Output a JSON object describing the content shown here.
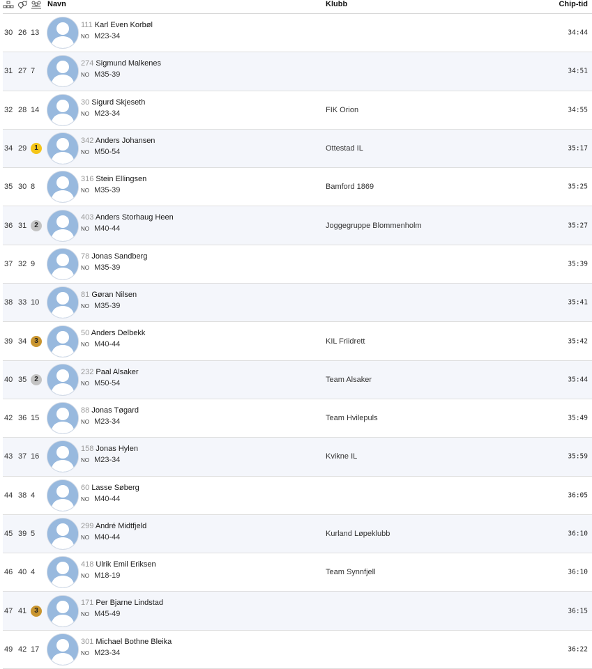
{
  "header": {
    "icons": [
      "overall-place-icon",
      "gender-place-icon",
      "class-place-icon"
    ],
    "navn": "Navn",
    "klubb": "Klubb",
    "chip": "Chip-tid"
  },
  "colors": {
    "gold": "#f5c518",
    "silver": "#c3c3c3",
    "bronze": "#c9952f",
    "avatar": "#98b9de",
    "row_alt": "#f4f6fb"
  },
  "rows": [
    {
      "place": "30",
      "gender": "26",
      "cls_place": "13",
      "medal": "",
      "bib": "111",
      "name": "Karl Even Korbøl",
      "nat": "NO",
      "cls": "M23-34",
      "club": "",
      "time": "34:44"
    },
    {
      "place": "31",
      "gender": "27",
      "cls_place": "7",
      "medal": "",
      "bib": "274",
      "name": "Sigmund Malkenes",
      "nat": "NO",
      "cls": "M35-39",
      "club": "",
      "time": "34:51"
    },
    {
      "place": "32",
      "gender": "28",
      "cls_place": "14",
      "medal": "",
      "bib": "30",
      "name": "Sigurd Skjeseth",
      "nat": "NO",
      "cls": "M23-34",
      "club": "FIK Orion",
      "time": "34:55"
    },
    {
      "place": "34",
      "gender": "29",
      "cls_place": "1",
      "medal": "gold",
      "bib": "342",
      "name": "Anders Johansen",
      "nat": "NO",
      "cls": "M50-54",
      "club": "Ottestad IL",
      "time": "35:17"
    },
    {
      "place": "35",
      "gender": "30",
      "cls_place": "8",
      "medal": "",
      "bib": "316",
      "name": "Stein Ellingsen",
      "nat": "NO",
      "cls": "M35-39",
      "club": "Bamford 1869",
      "time": "35:25"
    },
    {
      "place": "36",
      "gender": "31",
      "cls_place": "2",
      "medal": "silver",
      "bib": "403",
      "name": "Anders Storhaug Heen",
      "nat": "NO",
      "cls": "M40-44",
      "club": "Joggegruppe Blommenholm",
      "time": "35:27"
    },
    {
      "place": "37",
      "gender": "32",
      "cls_place": "9",
      "medal": "",
      "bib": "78",
      "name": "Jonas Sandberg",
      "nat": "NO",
      "cls": "M35-39",
      "club": "",
      "time": "35:39"
    },
    {
      "place": "38",
      "gender": "33",
      "cls_place": "10",
      "medal": "",
      "bib": "81",
      "name": "Gøran Nilsen",
      "nat": "NO",
      "cls": "M35-39",
      "club": "",
      "time": "35:41"
    },
    {
      "place": "39",
      "gender": "34",
      "cls_place": "3",
      "medal": "bronze",
      "bib": "50",
      "name": "Anders Delbekk",
      "nat": "NO",
      "cls": "M40-44",
      "club": "KIL Friidrett",
      "time": "35:42"
    },
    {
      "place": "40",
      "gender": "35",
      "cls_place": "2",
      "medal": "silver",
      "bib": "232",
      "name": "Paal Alsaker",
      "nat": "NO",
      "cls": "M50-54",
      "club": "Team Alsaker",
      "time": "35:44"
    },
    {
      "place": "42",
      "gender": "36",
      "cls_place": "15",
      "medal": "",
      "bib": "88",
      "name": "Jonas Tøgard",
      "nat": "NO",
      "cls": "M23-34",
      "club": "Team Hvilepuls",
      "time": "35:49"
    },
    {
      "place": "43",
      "gender": "37",
      "cls_place": "16",
      "medal": "",
      "bib": "158",
      "name": "Jonas Hylen",
      "nat": "NO",
      "cls": "M23-34",
      "club": "Kvikne IL",
      "time": "35:59"
    },
    {
      "place": "44",
      "gender": "38",
      "cls_place": "4",
      "medal": "",
      "bib": "60",
      "name": "Lasse Søberg",
      "nat": "NO",
      "cls": "M40-44",
      "club": "",
      "time": "36:05"
    },
    {
      "place": "45",
      "gender": "39",
      "cls_place": "5",
      "medal": "",
      "bib": "299",
      "name": "André Midtfjeld",
      "nat": "NO",
      "cls": "M40-44",
      "club": "Kurland Løpeklubb",
      "time": "36:10"
    },
    {
      "place": "46",
      "gender": "40",
      "cls_place": "4",
      "medal": "",
      "bib": "418",
      "name": "Ulrik Emil Eriksen",
      "nat": "NO",
      "cls": "M18-19",
      "club": "Team Synnfjell",
      "time": "36:10"
    },
    {
      "place": "47",
      "gender": "41",
      "cls_place": "3",
      "medal": "bronze",
      "bib": "171",
      "name": "Per Bjarne Lindstad",
      "nat": "NO",
      "cls": "M45-49",
      "club": "",
      "time": "36:15"
    },
    {
      "place": "49",
      "gender": "42",
      "cls_place": "17",
      "medal": "",
      "bib": "301",
      "name": "Michael Bothne Bleika",
      "nat": "NO",
      "cls": "M23-34",
      "club": "",
      "time": "36:22"
    }
  ]
}
